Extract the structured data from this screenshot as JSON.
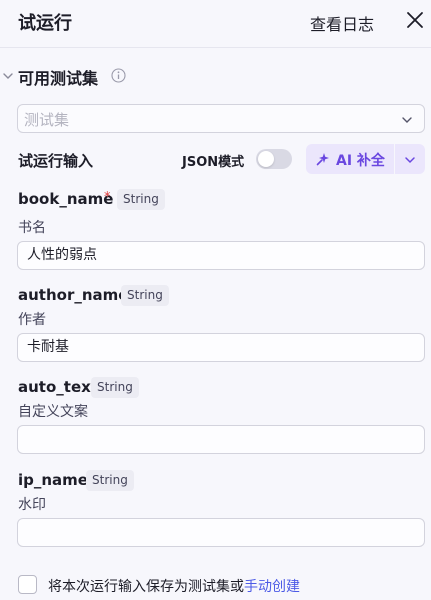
{
  "header": {
    "title": "试运行",
    "logs_label": "查看日志"
  },
  "testset_section": {
    "title": "可用测试集",
    "select_placeholder": "测试集"
  },
  "run_input": {
    "label": "试运行输入",
    "json_mode_label": "JSON模式",
    "json_mode_on": false,
    "ai_button_label": "AI 补全"
  },
  "fields": [
    {
      "name": "book_name",
      "required_mark": "*",
      "type": "String",
      "desc": "书名",
      "value": "人性的弱点"
    },
    {
      "name": "author_name",
      "type": "String",
      "desc": "作者",
      "value": "卡耐基"
    },
    {
      "name": "auto_text",
      "type": "String",
      "desc": "自定义文案",
      "value": ""
    },
    {
      "name": "ip_name",
      "type": "String",
      "desc": "水印",
      "value": ""
    }
  ],
  "footer": {
    "save_text": "将本次运行输入保存为测试集或",
    "manual_link": "手动创建",
    "checked": false
  },
  "colors": {
    "accent": "#6a47e0",
    "link": "#4d5be6",
    "required": "#e03a3a"
  }
}
